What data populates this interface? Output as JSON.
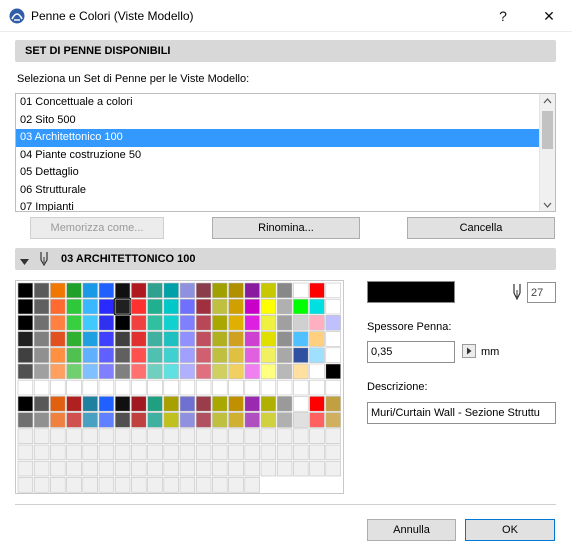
{
  "window": {
    "title": "Penne e Colori (Viste Modello)",
    "help_glyph": "?",
    "close_glyph": "✕"
  },
  "penset_section": {
    "title": "SET DI PENNE DISPONIBILI"
  },
  "list_prompt": "Seleziona un Set di Penne per le Viste Modello:",
  "pen_sets": [
    {
      "label": "01 Concettuale a colori",
      "selected": false
    },
    {
      "label": "02 Sito 500",
      "selected": false
    },
    {
      "label": "03 Architettonico 100",
      "selected": true
    },
    {
      "label": "04 Piante costruzione 50",
      "selected": false
    },
    {
      "label": "05 Dettaglio",
      "selected": false
    },
    {
      "label": "06 Strutturale",
      "selected": false
    },
    {
      "label": "07 Impianti",
      "selected": false
    }
  ],
  "buttons": {
    "store": "Memorizza come...",
    "rename": "Rinomina...",
    "delete": "Cancella",
    "cancel": "Annulla",
    "ok": "OK"
  },
  "pen_section": {
    "title": "03 ARCHITETTONICO 100"
  },
  "selected_pen": {
    "number": "27",
    "color": "#000000",
    "thickness_label": "Spessore Penna:",
    "thickness_value": "0,35",
    "unit": "mm",
    "description_label": "Descrizione:",
    "description_value": "Muri/Curtain Wall - Sezione Struttu"
  },
  "palette": {
    "columns": 20,
    "selected_index": 26,
    "rows": [
      [
        "#000000",
        "#5a5a5a",
        "#f07800",
        "#1fa02a",
        "#1a9ae6",
        "#2060ff",
        "#101010",
        "#b01820",
        "#30a090",
        "#00a0a8",
        "#9090e0",
        "#8a3c4a",
        "#a0a000",
        "#b09000",
        "#8a1aa0",
        "#c8c800",
        "#888888",
        "#ffffff",
        "#ff0000",
        "#ffffff"
      ],
      [
        "#000000",
        "#606060",
        "#ff6a30",
        "#2ec83a",
        "#3ab8ff",
        "#2a2aff",
        "#202020",
        "#ff3030",
        "#20b090",
        "#00c8c8",
        "#7070ff",
        "#a03040",
        "#c0c040",
        "#d0a000",
        "#c800c8",
        "#ffff00",
        "#b0b0b0",
        "#00ff00",
        "#00e0e0",
        "#ffffff"
      ],
      [
        "#000000",
        "#707070",
        "#ff8040",
        "#38d040",
        "#40c8ff",
        "#3030f0",
        "#000000",
        "#f04040",
        "#30c0a0",
        "#10d0d0",
        "#8080ff",
        "#b84858",
        "#a8a800",
        "#e0b000",
        "#e020e0",
        "#f0f040",
        "#a0a0a0",
        "#d0d0d0",
        "#ffb0c0",
        "#c0c0ff"
      ],
      [
        "#202020",
        "#808080",
        "#e05020",
        "#30b030",
        "#20a0e0",
        "#4040ff",
        "#404040",
        "#e03030",
        "#40b0a0",
        "#20c0c0",
        "#9090ff",
        "#c05060",
        "#b0b020",
        "#d0a020",
        "#d040d0",
        "#e0e000",
        "#909090",
        "#50c0ff",
        "#ffd080",
        "#ffffff"
      ],
      [
        "#404040",
        "#909090",
        "#ff9040",
        "#50c050",
        "#60b0ff",
        "#6060ff",
        "#606060",
        "#ff5050",
        "#50c0b0",
        "#40d0d0",
        "#a0a0ff",
        "#d06070",
        "#c0c040",
        "#e0c040",
        "#e060e0",
        "#f0f060",
        "#a8a8a8",
        "#3050a0",
        "#a0e0ff",
        "#ffffff"
      ],
      [
        "#505050",
        "#a0a0a0",
        "#ffa060",
        "#70d070",
        "#80c0ff",
        "#8080ff",
        "#808080",
        "#ff7070",
        "#70d0c0",
        "#60e0e0",
        "#b0b0ff",
        "#e07080",
        "#d0d060",
        "#f0d060",
        "#f080f0",
        "#ffff80",
        "#b8b8b8",
        "#ffe0a0",
        "#ffffff",
        "#000000"
      ],
      [
        "#ffffff",
        "#ffffff",
        "#ffffff",
        "#ffffff",
        "#ffffff",
        "#ffffff",
        "#ffffff",
        "#ffffff",
        "#ffffff",
        "#ffffff",
        "#ffffff",
        "#ffffff",
        "#ffffff",
        "#ffffff",
        "#ffffff",
        "#ffffff",
        "#ffffff",
        "#ffffff",
        "#ffffff",
        "#ffffff"
      ],
      [
        "#000000",
        "#585858",
        "#e06010",
        "#b02020",
        "#1f80a0",
        "#2060ff",
        "#101010",
        "#a01820",
        "#20a080",
        "#a8a000",
        "#7070d0",
        "#9a3c4a",
        "#a8a800",
        "#c09000",
        "#9a2ab0",
        "#b0b000",
        "#9a9a9a",
        "#ffffff",
        "#ff0000",
        "#c0a040"
      ],
      [
        "#707070",
        "#909090",
        "#f08040",
        "#d05050",
        "#4aa0c0",
        "#6080ff",
        "#505050",
        "#c04040",
        "#40b0a0",
        "#c0c020",
        "#9090e0",
        "#b05060",
        "#c0c040",
        "#d0b030",
        "#b050c0",
        "#d0d040",
        "#b0b0b0",
        "#e0e0e0",
        "#ff6060",
        "#d0b060"
      ],
      [
        "#f0f0f0",
        "#f0f0f0",
        "#f0f0f0",
        "#f0f0f0",
        "#f0f0f0",
        "#f0f0f0",
        "#f0f0f0",
        "#f0f0f0",
        "#f0f0f0",
        "#f0f0f0",
        "#f0f0f0",
        "#f0f0f0",
        "#f0f0f0",
        "#f0f0f0",
        "#f0f0f0",
        "#f0f0f0",
        "#f0f0f0",
        "#f0f0f0",
        "#f0f0f0",
        "#f0f0f0"
      ],
      [
        "#f0f0f0",
        "#f0f0f0",
        "#f0f0f0",
        "#f0f0f0",
        "#f0f0f0",
        "#f0f0f0",
        "#f0f0f0",
        "#f0f0f0",
        "#f0f0f0",
        "#f0f0f0",
        "#f0f0f0",
        "#f0f0f0",
        "#f0f0f0",
        "#f0f0f0",
        "#f0f0f0",
        "#f0f0f0",
        "#f0f0f0",
        "#f0f0f0",
        "#f0f0f0",
        "#f0f0f0"
      ],
      [
        "#f0f0f0",
        "#f0f0f0",
        "#f0f0f0",
        "#f0f0f0",
        "#f0f0f0",
        "#f0f0f0",
        "#f0f0f0",
        "#f0f0f0",
        "#f0f0f0",
        "#f0f0f0",
        "#f0f0f0",
        "#f0f0f0",
        "#f0f0f0",
        "#f0f0f0",
        "#f0f0f0",
        "#f0f0f0",
        "#f0f0f0",
        "#f0f0f0",
        "#f0f0f0",
        "#f0f0f0"
      ],
      [
        "#f0f0f0",
        "#f0f0f0",
        "#f0f0f0",
        "#f0f0f0",
        "#f0f0f0",
        "#f0f0f0",
        "#f0f0f0",
        "#f0f0f0",
        "#f0f0f0",
        "#f0f0f0",
        "#f0f0f0",
        "#f0f0f0",
        "#f0f0f0",
        "#f0f0f0",
        "#f0f0f0"
      ]
    ]
  },
  "colors": {
    "accent_selection": "#3399ff",
    "primary_button_border": "#0078d7"
  },
  "icons": {
    "app": "archicad-icon",
    "pen": "pen-nib-icon",
    "collapse": "triangle-down-icon",
    "arrow_right": "arrow-right-icon"
  }
}
